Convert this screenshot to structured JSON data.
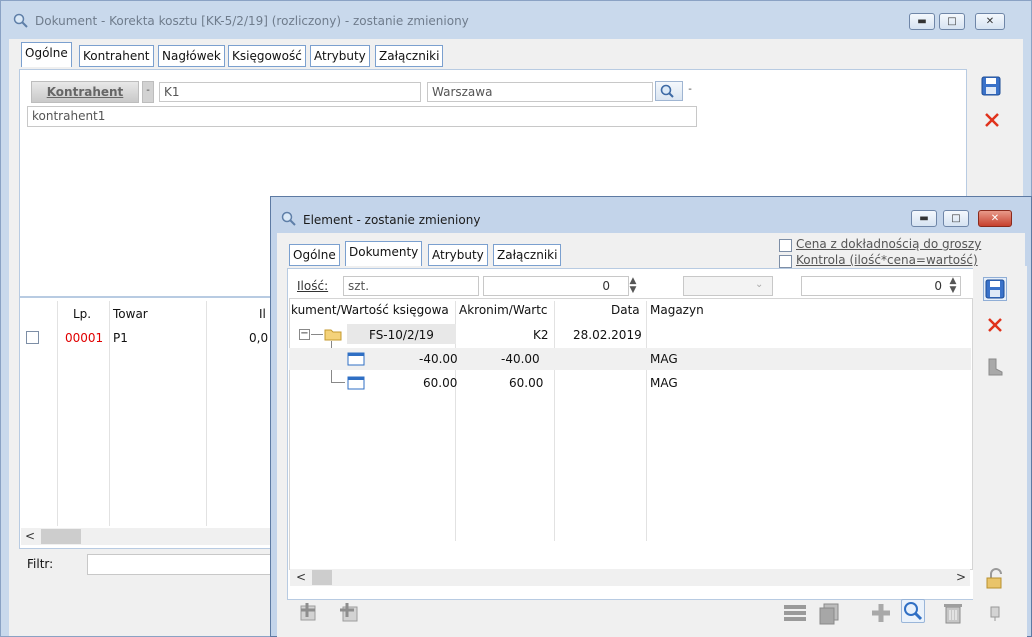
{
  "main_window": {
    "title": "Dokument - Korekta kosztu [KK-5/2/19] (rozliczony) - zostanie zmieniony",
    "tabs": [
      "Ogólne",
      "Kontrahent",
      "Nagłówek",
      "Księgowość",
      "Atrybuty",
      "Załączniki"
    ],
    "active_tab": "Ogólne",
    "kontrahent_button": "Kontrahent",
    "kontrahent_code": "K1",
    "kontrahent_city": "Warszawa",
    "kontrahent_name": "kontrahent1",
    "grid_headers": {
      "lp": "Lp.",
      "towar": "Towar",
      "il": "Il"
    },
    "rows": [
      {
        "lp": "00001",
        "towar": "P1",
        "il": "0,0"
      }
    ],
    "filter_label": "Filtr:"
  },
  "element_window": {
    "title": "Element - zostanie zmieniony",
    "tabs": [
      "Ogólne",
      "Dokumenty",
      "Atrybuty",
      "Załączniki"
    ],
    "active_tab": "Dokumenty",
    "checkbox1_label": "Cena z dokładnością do groszy",
    "checkbox2_label": "Kontrola (ilość*cena=wartość)",
    "ilosc_label": "Ilość:",
    "unit": "szt.",
    "spin1_value": "0",
    "spin2_value": "0",
    "grid_headers": {
      "dokument": "kument/Wartość księgowa",
      "akronim": "Akronim/Wartc",
      "data": "Data",
      "magazyn": "Magazyn"
    },
    "tree": [
      {
        "dokument": "FS-10/2/19",
        "akronim": "K2",
        "data": "28.02.2019",
        "magazyn": ""
      },
      {
        "dokument": "-40.00",
        "akronim": "-40.00",
        "data": "",
        "magazyn": "MAG"
      },
      {
        "dokument": "60.00",
        "akronim": "60.00",
        "data": "",
        "magazyn": "MAG"
      }
    ],
    "tree_toggle": "−"
  },
  "colors": {
    "title_bg": "#c9d9ec",
    "accent_blue": "#2f6fc4",
    "red_x": "#e0321c",
    "lp_red": "#e00000"
  }
}
